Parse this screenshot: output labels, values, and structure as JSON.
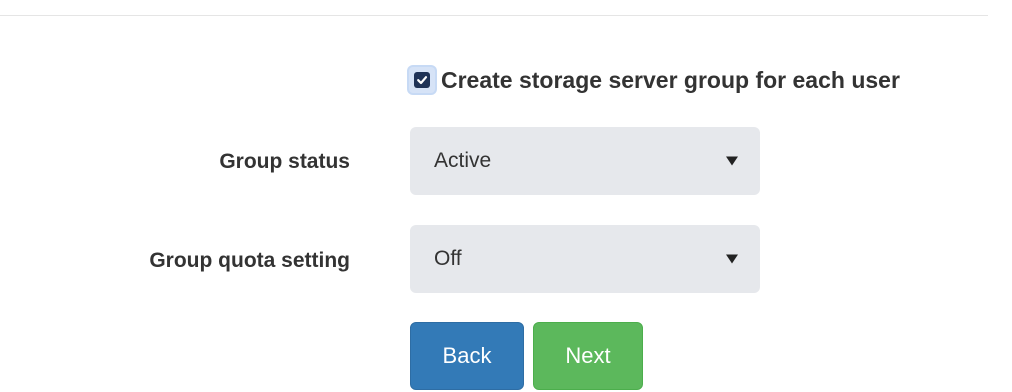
{
  "checkbox": {
    "label": "Create storage server group for each user",
    "checked": true
  },
  "group_status": {
    "label": "Group status",
    "value": "Active"
  },
  "group_quota": {
    "label": "Group quota setting",
    "value": "Off"
  },
  "buttons": {
    "back_label": "Back",
    "next_label": "Next"
  },
  "colors": {
    "back_button": "#337ab7",
    "next_button": "#5cb85c",
    "select_background": "#e6e8ec",
    "checkbox_fill": "#1f3357"
  }
}
